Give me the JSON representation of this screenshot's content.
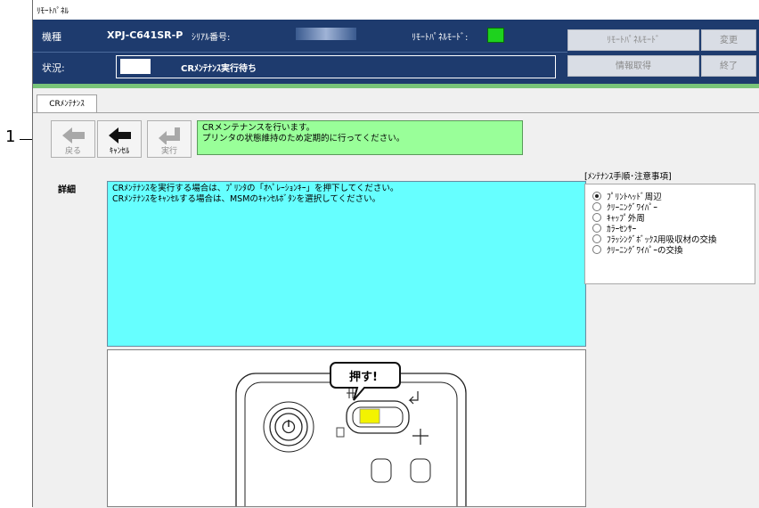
{
  "callout": {
    "number": "1"
  },
  "window": {
    "title": "ﾘﾓｰﾄﾊﾟﾈﾙ"
  },
  "header": {
    "model_label": "機種",
    "model_value": "XPJ-C641SR-P",
    "serial_label": "ｼﾘｱﾙ番号:",
    "remote_mode_label": "ﾘﾓｰﾄﾊﾟﾈﾙﾓｰﾄﾞ:",
    "status_label": "状況:",
    "status_value": "CRﾒﾝﾃﾅﾝｽ実行待ち",
    "buttons": {
      "remote_panel_mode": "ﾘﾓｰﾄﾊﾟﾈﾙﾓｰﾄﾞ",
      "change": "変更",
      "get_info": "情報取得",
      "exit": "終了"
    },
    "indicator_color": "#1ed21e"
  },
  "tab": {
    "label": "CRﾒﾝﾃﾅﾝｽ"
  },
  "toolbar": {
    "back": "戻る",
    "cancel": "ｷｬﾝｾﾙ",
    "execute": "実行"
  },
  "message": {
    "line1": "CRメンテナンスを行います。",
    "line2": "プリンタの状態維持のため定期的に行ってください。"
  },
  "detail": {
    "label": "詳細",
    "line1": "CRﾒﾝﾃﾅﾝｽを実行する場合は、ﾌﾟﾘﾝﾀの「ｵﾍﾟﾚｰｼｮﾝｷｰ」を押下してください。",
    "line2": "CRﾒﾝﾃﾅﾝｽをｷｬﾝｾﾙする場合は、MSMのｷｬﾝｾﾙﾎﾞﾀﾝを選択してください。"
  },
  "procedure": {
    "label": "[ﾒﾝﾃﾅﾝｽ手順･注意事項]",
    "items": [
      {
        "label": "ﾌﾟﾘﾝﾄﾍｯﾄﾞ周辺",
        "selected": true
      },
      {
        "label": "ｸﾘｰﾆﾝｸﾞﾜｲﾊﾟｰ",
        "selected": false
      },
      {
        "label": "ｷｬｯﾌﾟ外周",
        "selected": false
      },
      {
        "label": "ｶﾗｰｾﾝｻｰ",
        "selected": false
      },
      {
        "label": "ﾌﾗｯｼﾝｸﾞﾎﾞｯｸｽ用吸収材の交換",
        "selected": false
      },
      {
        "label": "ｸﾘｰﾆﾝｸﾞﾜｲﾊﾟｰの交換",
        "selected": false
      }
    ]
  },
  "illustration": {
    "bubble": "押す!"
  }
}
